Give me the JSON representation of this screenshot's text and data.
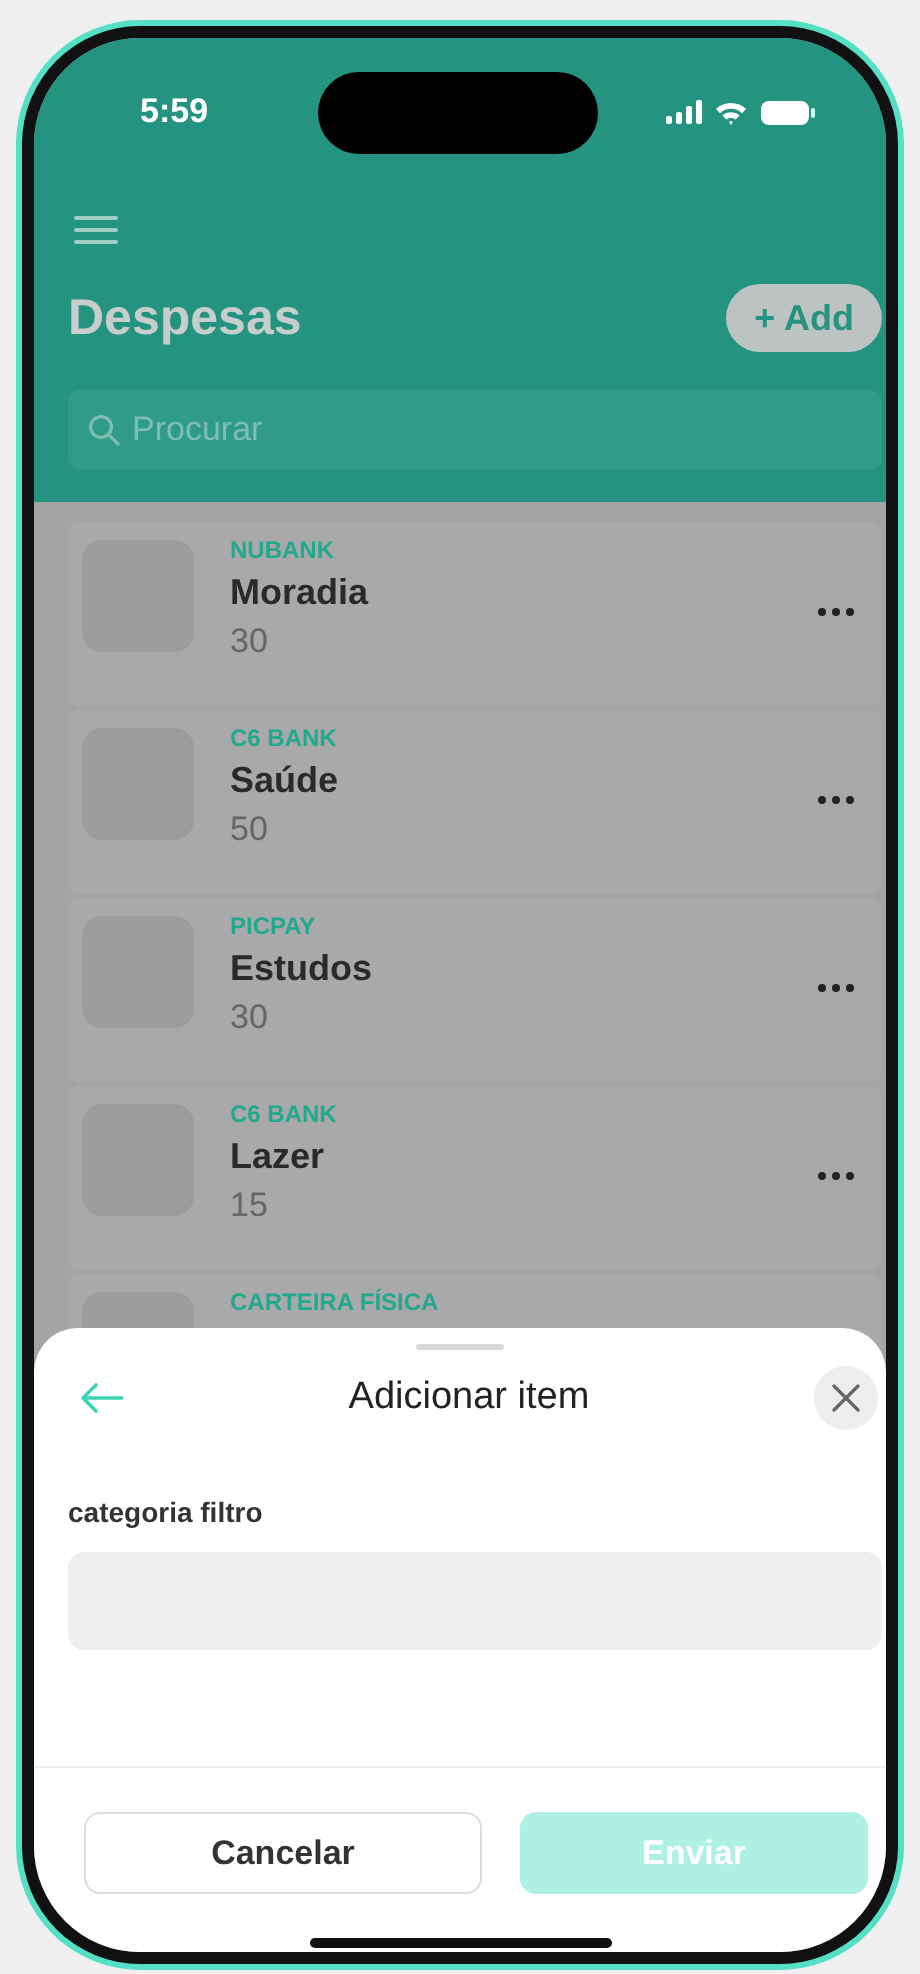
{
  "status_bar": {
    "time": "5:59"
  },
  "header": {
    "title": "Despesas",
    "add_button": "+ Add",
    "search": {
      "placeholder": "Procurar"
    }
  },
  "items": [
    {
      "account": "NUBANK",
      "name": "Moradia",
      "amount": "30"
    },
    {
      "account": "C6 BANK",
      "name": "Saúde",
      "amount": "50"
    },
    {
      "account": "PICPAY",
      "name": "Estudos",
      "amount": "30"
    },
    {
      "account": "C6 BANK",
      "name": "Lazer",
      "amount": "15"
    },
    {
      "account": "CARTEIRA FÍSICA"
    }
  ],
  "sheet": {
    "title": "Adicionar item",
    "field_label": "categoria filtro",
    "buttons": [
      {
        "label": "Cancelar",
        "kind": "secondary",
        "disabled": false
      },
      {
        "label": "Enviar",
        "kind": "primary",
        "disabled": true
      }
    ]
  }
}
